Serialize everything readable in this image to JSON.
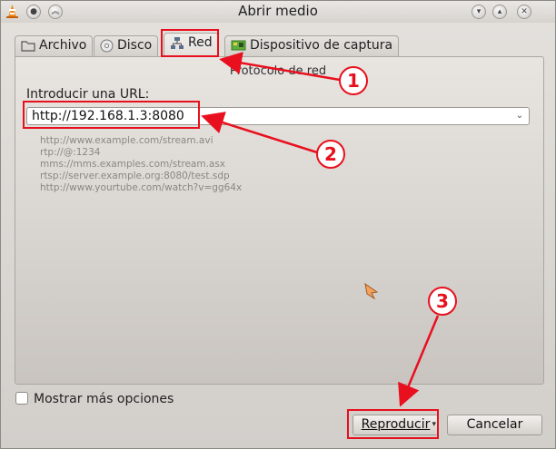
{
  "window": {
    "title": "Abrir medio"
  },
  "tabs": [
    {
      "label": "Archivo",
      "icon": "folder-icon"
    },
    {
      "label": "Disco",
      "icon": "disc-icon"
    },
    {
      "label": "Red",
      "icon": "network-icon"
    },
    {
      "label": "Dispositivo de captura",
      "icon": "capture-card-icon"
    }
  ],
  "network": {
    "group_label": "Protocolo de red",
    "url_label": "Introducir una URL:",
    "url_value": "http://192.168.1.3:8080",
    "examples": [
      "http://www.example.com/stream.avi",
      "rtp://@:1234",
      "mms://mms.examples.com/stream.asx",
      "rtsp://server.example.org:8080/test.sdp",
      "http://www.yourtube.com/watch?v=gg64x"
    ]
  },
  "options": {
    "more_options_label": "Mostrar más opciones"
  },
  "buttons": {
    "play": "Reproducir",
    "cancel": "Cancelar"
  },
  "annotations": {
    "step1": "1",
    "step2": "2",
    "step3": "3",
    "color": "#e8101e"
  }
}
